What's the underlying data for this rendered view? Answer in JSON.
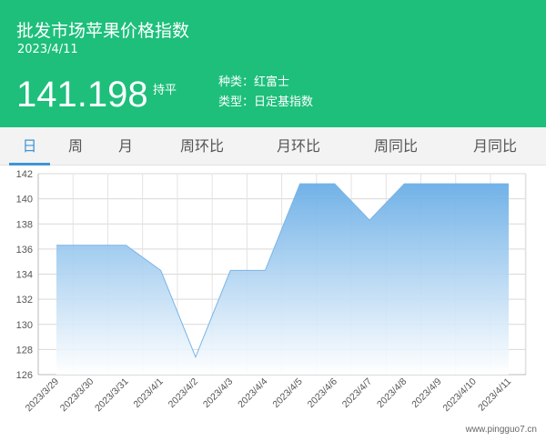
{
  "header": {
    "title": "批发市场苹果价格指数",
    "date": "2023/4/11",
    "value": "141.198",
    "trend": "持平",
    "category": "种类：红富士",
    "type": "类型：日定基指数"
  },
  "tabs": [
    {
      "label": "日",
      "active": true
    },
    {
      "label": "周",
      "active": false
    },
    {
      "label": "月",
      "active": false
    },
    {
      "label": "周环比",
      "active": false
    },
    {
      "label": "月环比",
      "active": false
    },
    {
      "label": "周同比",
      "active": false
    },
    {
      "label": "月同比",
      "active": false
    }
  ],
  "colors": {
    "header_bg": "#1dbf7b",
    "tab_active": "#3f95d6",
    "area_top": "#6aaee6",
    "area_bottom": "#ffffff",
    "line": "#7ab4e6"
  },
  "chart_data": {
    "type": "area",
    "title": "",
    "xlabel": "",
    "ylabel": "",
    "categories": [
      "2023/3/29",
      "2023/3/30",
      "2023/3/31",
      "2023/4/1",
      "2023/4/2",
      "2023/4/3",
      "2023/4/4",
      "2023/4/5",
      "2023/4/6",
      "2023/4/7",
      "2023/4/8",
      "2023/4/9",
      "2023/4/10",
      "2023/4/11"
    ],
    "values": [
      136.3,
      136.3,
      136.3,
      134.3,
      127.4,
      134.3,
      134.3,
      141.2,
      141.2,
      138.3,
      141.2,
      141.2,
      141.2,
      141.2
    ],
    "ylim": [
      126,
      142
    ],
    "yticks": [
      126,
      128,
      130,
      132,
      134,
      136,
      138,
      140,
      142
    ],
    "grid": true
  },
  "watermark": "www.pingguo7.cn"
}
